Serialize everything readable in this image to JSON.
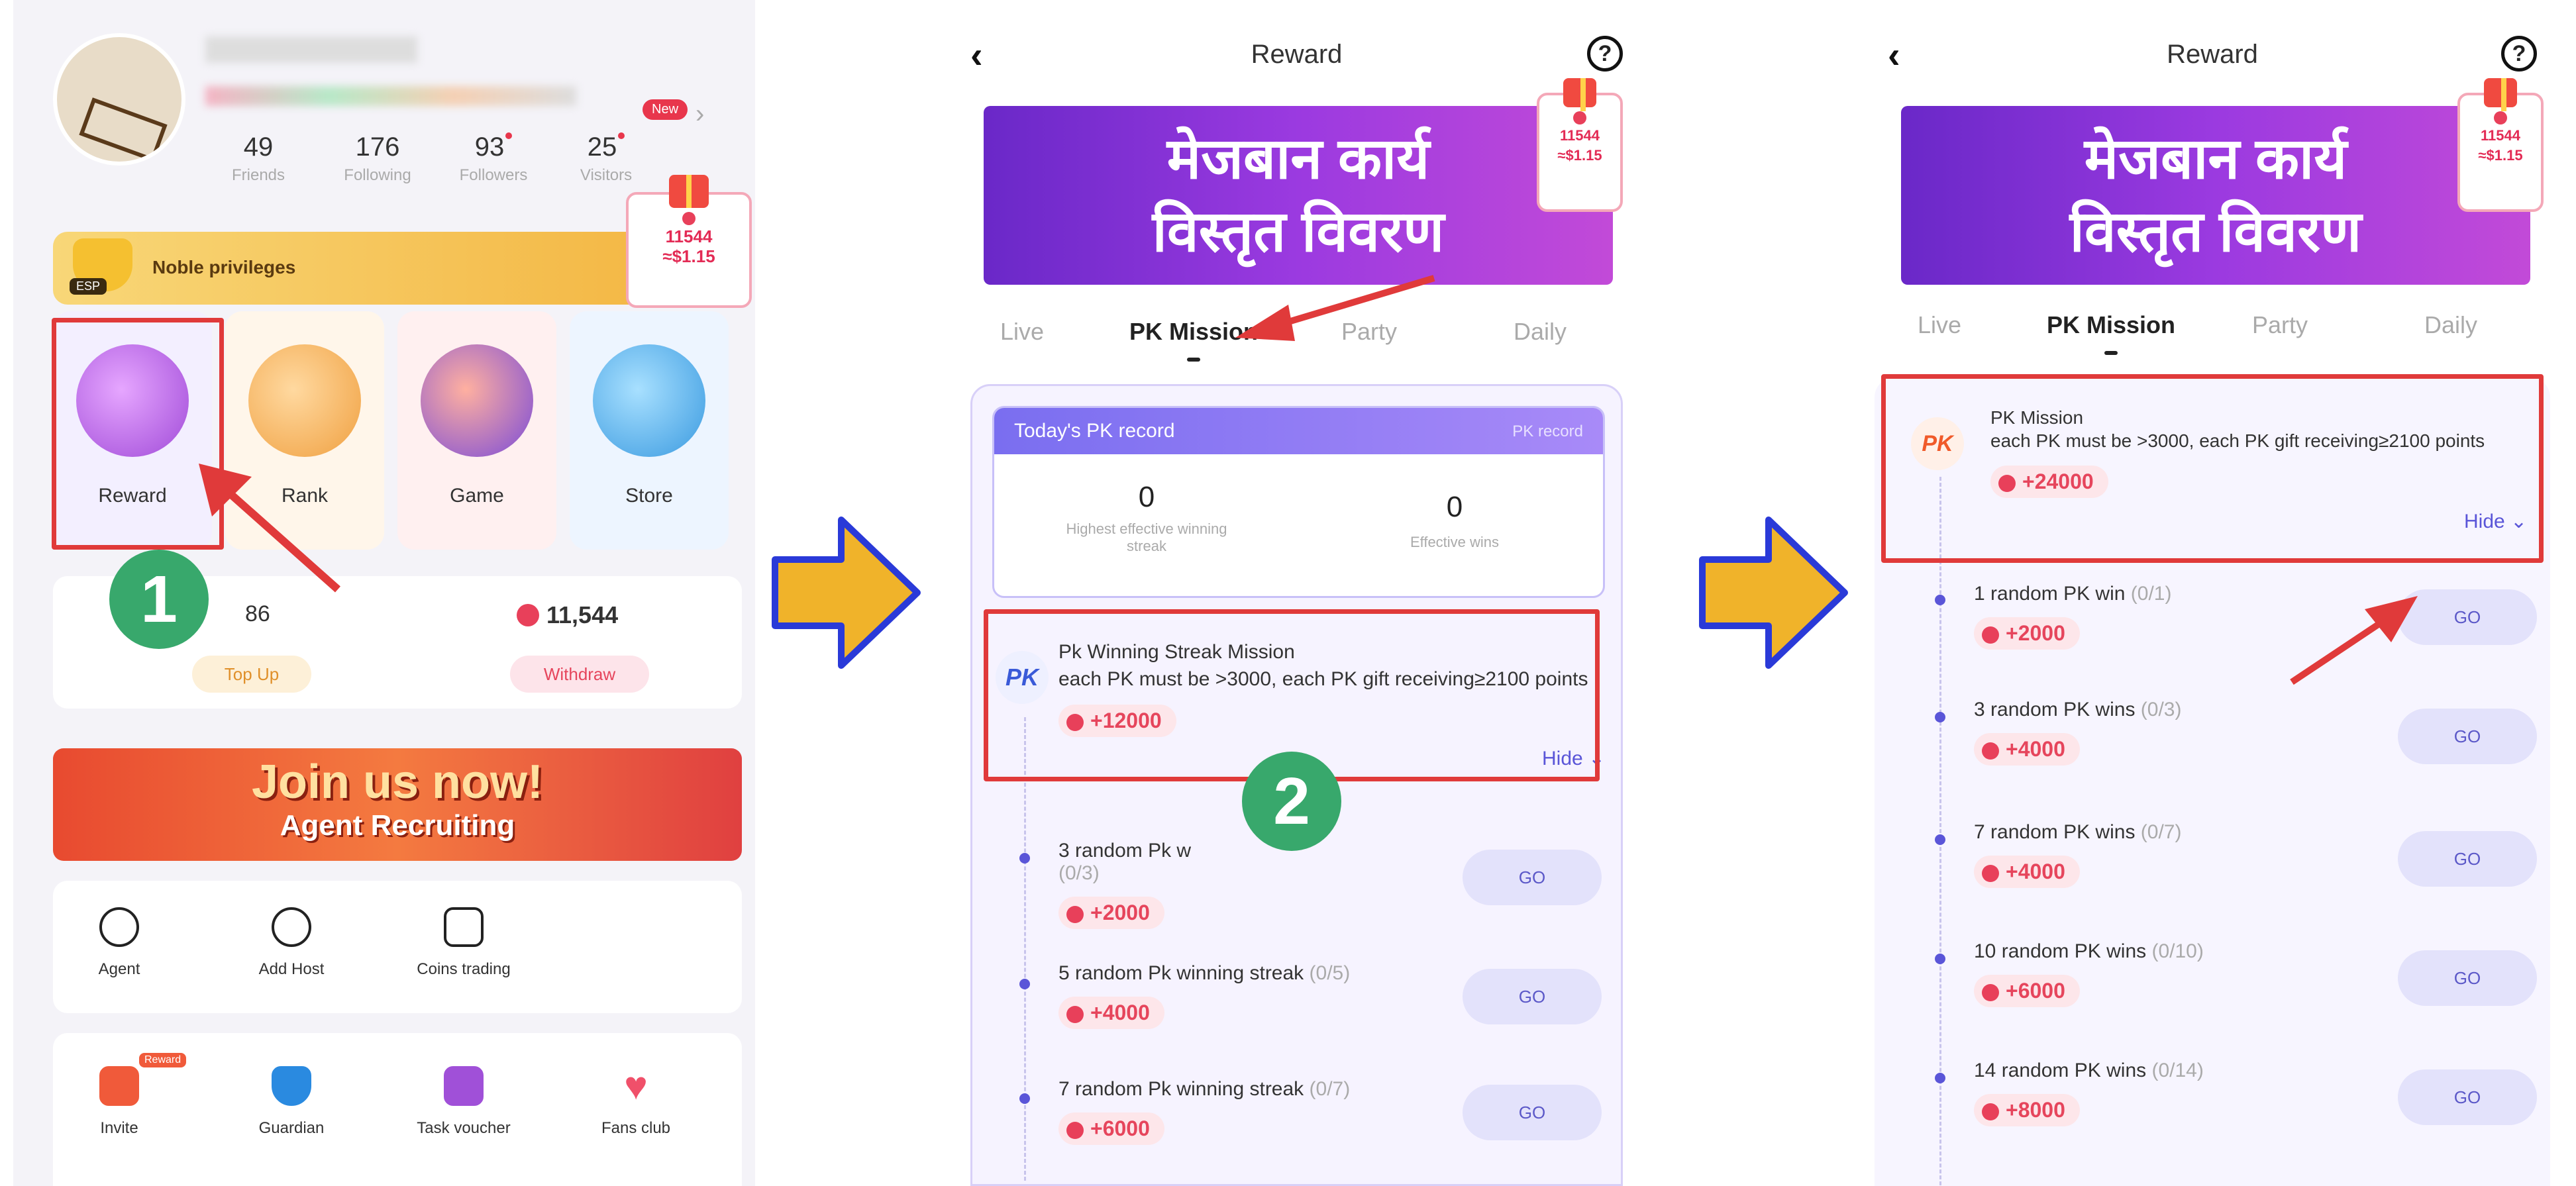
{
  "colors": {
    "accent": "#5b58c8",
    "highlight": "#e03a3a",
    "reward": "#e6455c",
    "arrow": "#f0b32a"
  },
  "panel1": {
    "stats": [
      {
        "value": "49",
        "label": "Friends"
      },
      {
        "value": "176",
        "label": "Following"
      },
      {
        "value": "93",
        "label": "Followers"
      },
      {
        "value": "25",
        "label": "Visitors"
      }
    ],
    "new_badge": "New",
    "noble": {
      "badge": "ESP",
      "label": "Noble privileges"
    },
    "gift": {
      "value": "11544",
      "money": "≈$1.15"
    },
    "quick": [
      {
        "label": "Reward",
        "icon": "reward-icon"
      },
      {
        "label": "Rank",
        "icon": "rank-icon"
      },
      {
        "label": "Game",
        "icon": "game-icon"
      },
      {
        "label": "Store",
        "icon": "store-icon"
      }
    ],
    "wallet": {
      "coins_partial": "86",
      "topup": "Top Up",
      "diamonds": "11,544",
      "withdraw": "Withdraw"
    },
    "step1": "1",
    "promo": {
      "line1": "Join us now!",
      "line2": "Agent Recruiting"
    },
    "tools": [
      {
        "label": "Agent"
      },
      {
        "label": "Add Host"
      },
      {
        "label": "Coins trading"
      }
    ],
    "bottom": [
      {
        "label": "Invite",
        "badge": "Reward"
      },
      {
        "label": "Guardian"
      },
      {
        "label": "Task voucher"
      },
      {
        "label": "Fans club"
      }
    ]
  },
  "header": {
    "title": "Reward"
  },
  "banner": {
    "line1": "मेजबान कार्य",
    "line2": "विस्तृत विवरण"
  },
  "tabs": [
    "Live",
    "PK Mission",
    "Party",
    "Daily"
  ],
  "panel2": {
    "record": {
      "title": "Today's PK record",
      "link": "PK record",
      "v1": "0",
      "l1": "Highest effective winning streak",
      "v2": "0",
      "l2": "Effective wins"
    },
    "main": {
      "title": "Pk Winning Streak Mission",
      "desc": "each PK must be >3000, each PK gift receiving≥2100 points",
      "reward": "+12000",
      "hide": "Hide"
    },
    "step2": "2",
    "tasks": [
      {
        "title": "3 random Pk w",
        "count": "(0/3)",
        "reward": "+2000",
        "go": "GO"
      },
      {
        "title": "5 random Pk winning streak",
        "count": "(0/5)",
        "reward": "+4000",
        "go": "GO"
      },
      {
        "title": "7 random Pk winning streak",
        "count": "(0/7)",
        "reward": "+6000",
        "go": "GO"
      }
    ]
  },
  "panel3": {
    "main": {
      "badge": "PK",
      "title": "PK Mission",
      "desc": "each PK must be >3000, each PK gift receiving≥2100 points",
      "reward": "+24000",
      "hide": "Hide"
    },
    "tasks": [
      {
        "title": "1 random PK win",
        "count": "(0/1)",
        "reward": "+2000",
        "go": "GO"
      },
      {
        "title": "3 random PK wins",
        "count": "(0/3)",
        "reward": "+4000",
        "go": "GO"
      },
      {
        "title": "7 random PK wins",
        "count": "(0/7)",
        "reward": "+4000",
        "go": "GO"
      },
      {
        "title": "10 random PK wins",
        "count": "(0/10)",
        "reward": "+6000",
        "go": "GO"
      },
      {
        "title": "14 random PK wins",
        "count": "(0/14)",
        "reward": "+8000",
        "go": "GO"
      }
    ]
  }
}
